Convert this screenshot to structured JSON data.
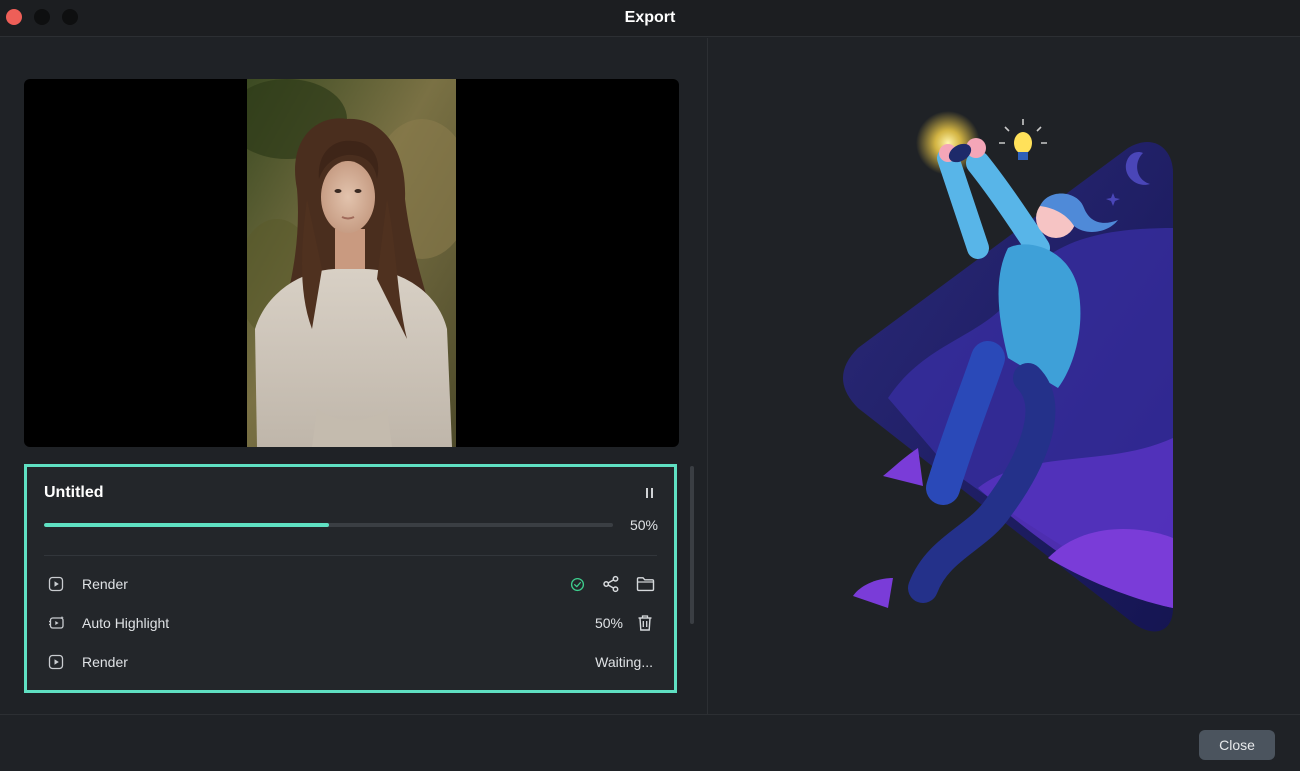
{
  "window": {
    "title": "Export"
  },
  "task": {
    "title": "Untitled",
    "progress_percent": 50,
    "progress_label": "50%",
    "steps": [
      {
        "icon": "play-square-icon",
        "label": "Render",
        "status": "done"
      },
      {
        "icon": "auto-highlight-icon",
        "label": "Auto Highlight",
        "status_text": "50%"
      },
      {
        "icon": "play-square-icon",
        "label": "Render",
        "status_text": "Waiting..."
      }
    ]
  },
  "footer": {
    "close_label": "Close"
  },
  "colors": {
    "accent": "#5fe0c2",
    "success": "#3ecf8e",
    "close_traffic": "#ee5f58",
    "button_bg": "#4b545e"
  },
  "icons": [
    "pause-icon",
    "check-circle-icon",
    "share-icon",
    "folder-icon",
    "trash-icon",
    "play-square-icon",
    "auto-highlight-icon"
  ]
}
